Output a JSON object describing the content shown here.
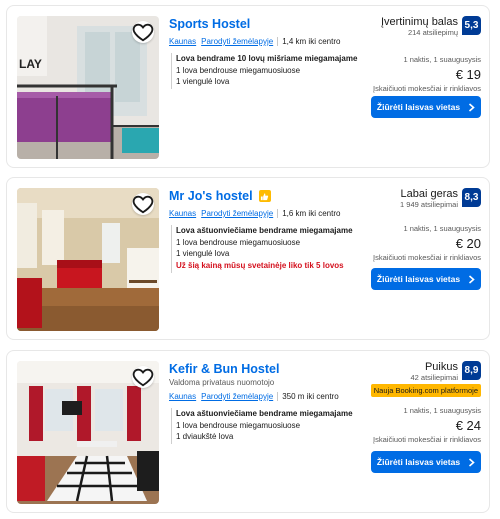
{
  "listings": [
    {
      "name": "Sports Hostel",
      "subtitle": "",
      "genius": false,
      "city": "Kaunas",
      "map_link": "Parodyti žemėlapyje",
      "distance": "1,4 km iki centro",
      "room_title": "Lova bendrame 10 lovų mišriame miegamajame",
      "beds": [
        "1 lova bendrouse miegamuosiuose",
        "1 viengulė lova"
      ],
      "warning": "",
      "score_word": "Įvertinimų balas",
      "review_count": "214 atsiliepimų",
      "score": "5,3",
      "new_badge": "",
      "nights": "1 naktis, 1 suaugusysis",
      "price": "€ 19",
      "tax_note": "Įskaičiuoti mokesčiai ir rinkliavos",
      "cta": "Žiūrėti laisvas vietas",
      "photo": "hostel-dorm-bunk-beds"
    },
    {
      "name": "Mr Jo's hostel",
      "subtitle": "",
      "genius": true,
      "city": "Kaunas",
      "map_link": "Parodyti žemėlapyje",
      "distance": "1,6 km iki centro",
      "room_title": "Lova aštuonviečiame bendrame miegamajame",
      "beds": [
        "1 lova bendrouse miegamuosiuose",
        "1 viengulė lova"
      ],
      "warning": "Už šią kainą mūsų svetainėje liko tik 5 lovos",
      "score_word": "Labai geras",
      "review_count": "1 949 atsiliepimai",
      "score": "8,3",
      "new_badge": "",
      "nights": "1 naktis, 1 suaugusysis",
      "price": "€ 20",
      "tax_note": "Įskaičiuoti mokesčiai ir rinkliavos",
      "cta": "Žiūrėti laisvas vietas",
      "photo": "lounge-red-sofas"
    },
    {
      "name": "Kefir & Bun Hostel",
      "subtitle": "Valdoma privataus nuomotojo",
      "genius": false,
      "city": "Kaunas",
      "map_link": "Parodyti žemėlapyje",
      "distance": "350 m iki centro",
      "room_title": "Lova aštuonviečiame bendrame miegamajame",
      "beds": [
        "1 lova bendrouse miegamuosiuose",
        "1 dviaukštė lova"
      ],
      "warning": "",
      "score_word": "Puikus",
      "review_count": "42 atsiliepimai",
      "score": "8,9",
      "new_badge": "Nauja Booking.com platformoje",
      "nights": "1 naktis, 1 suaugusysis",
      "price": "€ 24",
      "tax_note": "Įskaičiuoti mokesčiai ir rinkliavos",
      "cta": "Žiūrėti laisvas vietas",
      "photo": "common-room-red-curtains"
    }
  ],
  "colors": {
    "link": "#006ce4",
    "score_badge": "#003b95",
    "warning": "#d4111e",
    "new_badge": "#ffb700"
  }
}
